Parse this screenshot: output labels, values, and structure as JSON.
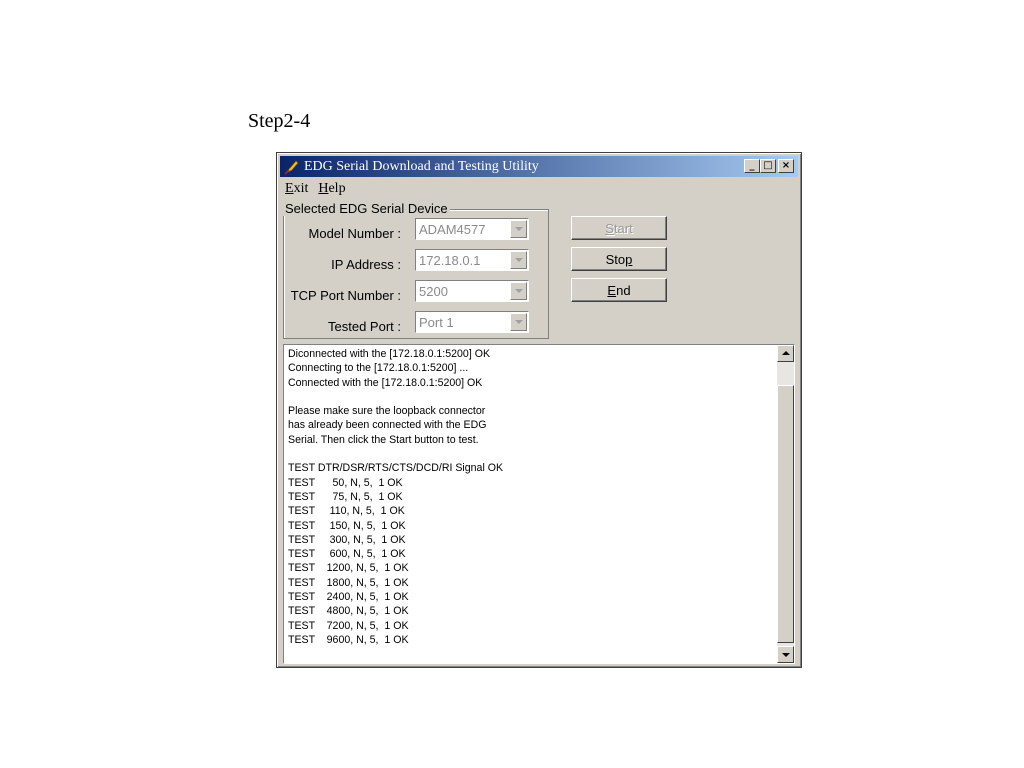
{
  "step_label": "Step2-4",
  "window": {
    "title": "EDG Serial Download and Testing Utility",
    "icon": "feather-app-icon",
    "controls": {
      "minimize": "_",
      "maximize": "□",
      "close": "×"
    }
  },
  "menu": [
    {
      "underline": "E",
      "rest": "xit"
    },
    {
      "underline": "H",
      "rest": "elp"
    }
  ],
  "device_group": {
    "title": "Selected EDG Serial Device",
    "fields": [
      {
        "label": "Model Number :",
        "value": "ADAM4577"
      },
      {
        "label": "IP Address :",
        "value": "172.18.0.1"
      },
      {
        "label": "TCP Port Number :",
        "value": "5200"
      },
      {
        "label": "Tested Port :",
        "value": "Port 1"
      }
    ]
  },
  "buttons": {
    "start": {
      "pre": "",
      "underline": "S",
      "post": "tart",
      "enabled": false
    },
    "stop": {
      "pre": "Sto",
      "underline": "p",
      "post": "",
      "enabled": true
    },
    "end": {
      "pre": "",
      "underline": "E",
      "post": "nd",
      "enabled": true
    }
  },
  "log_lines": [
    "Diconnected with the [172.18.0.1:5200] OK",
    "Connecting to the [172.18.0.1:5200] ...",
    "Connected with the [172.18.0.1:5200] OK",
    "",
    "Please make sure the loopback connector",
    "has already been connected with the EDG",
    "Serial. Then click the Start button to test.",
    "",
    "TEST DTR/DSR/RTS/CTS/DCD/RI Signal OK",
    "TEST      50, N, 5,  1 OK",
    "TEST      75, N, 5,  1 OK",
    "TEST     110, N, 5,  1 OK",
    "TEST     150, N, 5,  1 OK",
    "TEST     300, N, 5,  1 OK",
    "TEST     600, N, 5,  1 OK",
    "TEST    1200, N, 5,  1 OK",
    "TEST    1800, N, 5,  1 OK",
    "TEST    2400, N, 5,  1 OK",
    "TEST    4800, N, 5,  1 OK",
    "TEST    7200, N, 5,  1 OK",
    "TEST    9600, N, 5,  1 OK"
  ],
  "colors": {
    "titlebar_start": "#0a246a",
    "titlebar_end": "#a6caf0",
    "window_face": "#d4d0c8"
  }
}
